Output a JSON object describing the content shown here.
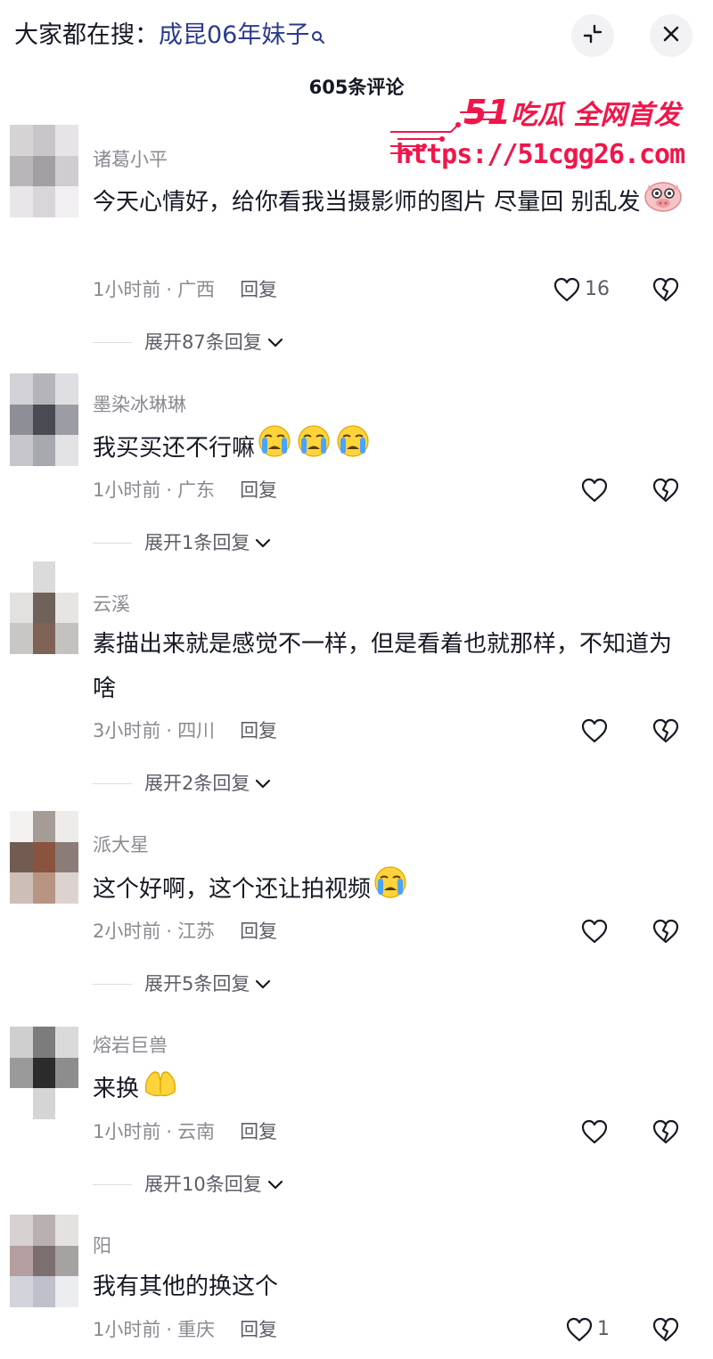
{
  "header": {
    "search_prefix": "大家都在搜：",
    "search_query": "成昆06年妹子",
    "search_icon": "search-icon",
    "collapse_icon": "collapse-icon",
    "close_icon": "close-icon"
  },
  "comment_count": "605条评论",
  "watermark": {
    "brand_number": "51",
    "brand_text": "吃瓜 全网首发",
    "url": "https://51cgg26.com"
  },
  "colors": {
    "accent_watermark": "#f0164a",
    "search_query": "#2b3a8f",
    "meta_gray": "#8a8b91"
  },
  "comments": [
    {
      "username": "诸葛小平",
      "text": "今天心情好，给你看我当摄影师的图片 尽量回 别乱发",
      "emoji": "pig-face-emoji",
      "time": "1小时前",
      "location": "广西",
      "reply_label": "回复",
      "like_count": "16",
      "expand_label": "展开87条回复"
    },
    {
      "username": "墨染冰琳琳",
      "text": "我买买还不行嘛",
      "emoji": "crying-face-emoji x3",
      "time": "1小时前",
      "location": "广东",
      "reply_label": "回复",
      "like_count": "",
      "expand_label": "展开1条回复"
    },
    {
      "username": "云溪",
      "text": "素描出来就是感觉不一样，但是看着也就那样，不知道为啥",
      "emoji": "",
      "time": "3小时前",
      "location": "四川",
      "reply_label": "回复",
      "like_count": "",
      "expand_label": "展开2条回复"
    },
    {
      "username": "派大星",
      "text": "这个好啊，这个还让拍视频",
      "emoji": "crying-face-emoji",
      "time": "2小时前",
      "location": "江苏",
      "reply_label": "回复",
      "like_count": "",
      "expand_label": "展开5条回复"
    },
    {
      "username": "熔岩巨兽",
      "text": "来换",
      "emoji": "pray-hands-emoji",
      "time": "1小时前",
      "location": "云南",
      "reply_label": "回复",
      "like_count": "",
      "expand_label": "展开10条回复"
    },
    {
      "username": "阳",
      "text": "我有其他的换这个",
      "emoji": "",
      "time": "1小时前",
      "location": "重庆",
      "reply_label": "回复",
      "like_count": "1",
      "expand_label": ""
    }
  ]
}
